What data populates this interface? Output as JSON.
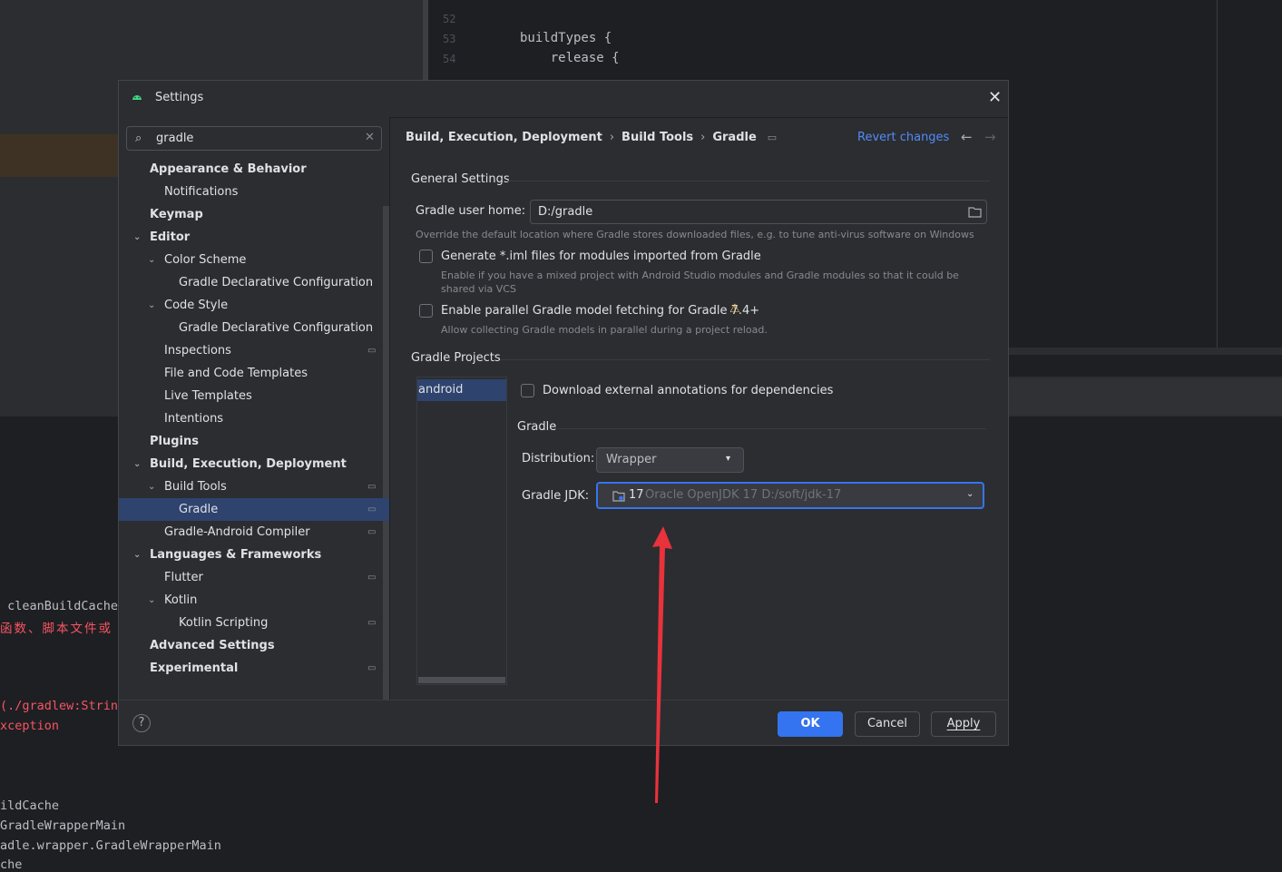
{
  "background": {
    "line_numbers": [
      "52",
      "53",
      "54"
    ],
    "code_lines": [
      "buildTypes {",
      "    release {"
    ],
    "terminal_lines": [
      " cleanBuildCache",
      "函数、脚本文件或",
      "(./gradlew:Strin",
      "xception",
      "ildCache",
      "GradleWrapperMain",
      "adle.wrapper.GradleWrapperMain",
      "che"
    ]
  },
  "dialog": {
    "title": "Settings",
    "close_glyph": "✕",
    "search": {
      "value": "gradle",
      "icon": "search-icon",
      "clear": "✕"
    },
    "tree": [
      {
        "label": "Appearance & Behavior",
        "bold": true
      },
      {
        "label": "Notifications"
      },
      {
        "label": "Keymap",
        "bold": true
      },
      {
        "label": "Editor",
        "bold": true
      },
      {
        "label": "Color Scheme"
      },
      {
        "label": "Gradle Declarative Configuration Language"
      },
      {
        "label": "Code Style"
      },
      {
        "label": "Gradle Declarative Configuration Language"
      },
      {
        "label": "Inspections"
      },
      {
        "label": "File and Code Templates"
      },
      {
        "label": "Live Templates"
      },
      {
        "label": "Intentions"
      },
      {
        "label": "Plugins",
        "bold": true
      },
      {
        "label": "Build, Execution, Deployment",
        "bold": true
      },
      {
        "label": "Build Tools"
      },
      {
        "label": "Gradle",
        "selected": true
      },
      {
        "label": "Gradle-Android Compiler"
      },
      {
        "label": "Languages & Frameworks",
        "bold": true
      },
      {
        "label": "Flutter"
      },
      {
        "label": "Kotlin"
      },
      {
        "label": "Kotlin Scripting"
      },
      {
        "label": "Advanced Settings",
        "bold": true
      },
      {
        "label": "Experimental",
        "bold": true
      }
    ],
    "breadcrumb": [
      "Build, Execution, Deployment",
      "Build Tools",
      "Gradle"
    ],
    "revert_label": "Revert changes",
    "general": {
      "title": "General Settings",
      "user_home_label": "Gradle user home:",
      "user_home_value": "D:/gradle",
      "user_home_hint": "Override the default location where Gradle stores downloaded files, e.g. to tune anti-virus software on Windows",
      "iml_label": "Generate *.iml files for modules imported from Gradle",
      "iml_hint": "Enable if you have a mixed project with Android Studio modules and Gradle modules so that it could be shared via VCS",
      "iml_checked": false,
      "parallel_label": "Enable parallel Gradle model fetching for Gradle 7.4+",
      "parallel_hint": "Allow collecting Gradle models in parallel during a project reload.",
      "parallel_checked": false
    },
    "projects": {
      "title": "Gradle Projects",
      "items": [
        "android"
      ],
      "annotations_label": "Download external annotations for dependencies",
      "annotations_checked": false,
      "gradle_section": "Gradle",
      "distribution_label": "Distribution:",
      "distribution_value": "Wrapper",
      "jdk_label": "Gradle JDK:",
      "jdk_version": "17",
      "jdk_value": "Oracle OpenJDK 17 D:/soft/jdk-17"
    },
    "footer": {
      "help": "?",
      "ok": "OK",
      "cancel": "Cancel",
      "apply": "Apply"
    }
  },
  "colors": {
    "accent": "#3574f0",
    "selection": "#2e436e",
    "annotation_arrow": "#e8323c"
  }
}
